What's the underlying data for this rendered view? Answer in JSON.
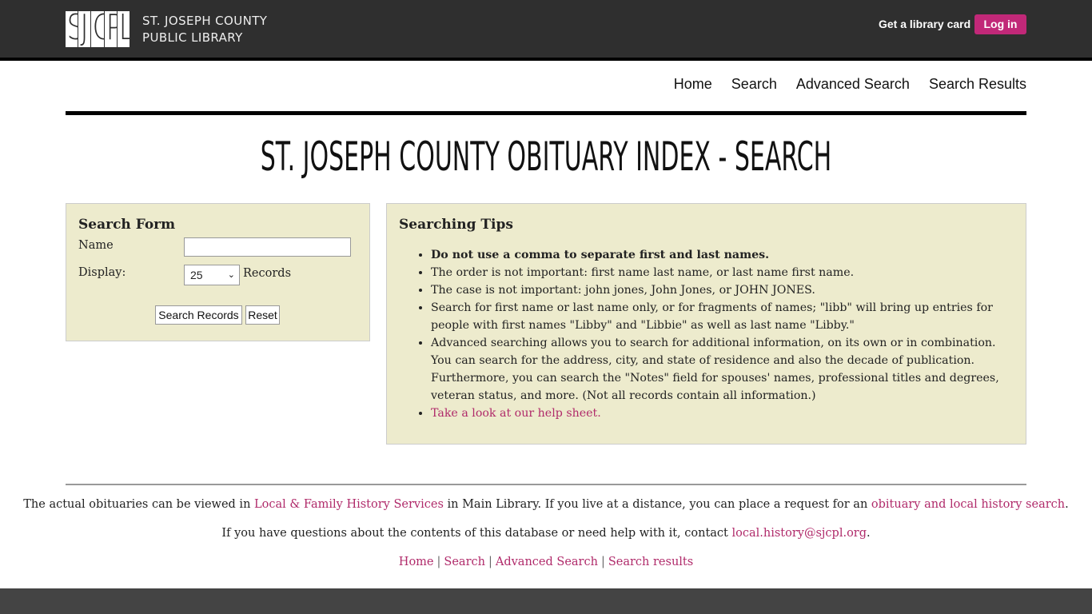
{
  "header": {
    "logo_letters": [
      "S",
      "J",
      "C",
      "P",
      "L"
    ],
    "org_line1": "ST. JOSEPH COUNTY",
    "org_line2": "PUBLIC LIBRARY",
    "get_card": "Get a library card",
    "login": "Log in",
    "accent_color": "#c12878"
  },
  "nav": {
    "items": [
      "Home",
      "Search",
      "Advanced Search",
      "Search Results"
    ]
  },
  "page_title": "ST. JOSEPH COUNTY OBITUARY INDEX - SEARCH",
  "search_form": {
    "heading": "Search Form",
    "name_label": "Name",
    "name_value": "",
    "display_label": "Display:",
    "display_value": "25",
    "records_label": "Records",
    "search_button": "Search Records",
    "reset_button": "Reset"
  },
  "tips": {
    "heading": "Searching Tips",
    "items": [
      "Do not use a comma to separate first and last names.",
      "The order is not important: first name last name, or last name first name.",
      "The case is not important: john jones, John Jones, or JOHN JONES.",
      "Search for first name or last name only, or for fragments of names; \"libb\" will bring up entries for people with first names \"Libby\" and \"Libbie\" as well as last name \"Libby.\"",
      "Advanced searching allows you to search for additional information, on its own or in combination. You can search for the address, city, and state of residence and also the decade of publication. Furthermore, you can search the \"Notes\" field for spouses' names, professional titles and degrees, veteran status, and more. (Not all records contain all information.)",
      "Take a look at our help sheet."
    ]
  },
  "footer": {
    "line1_pre": "The actual obituaries can be viewed in ",
    "line1_link1": "Local & Family History Services",
    "line1_mid": " in Main Library. If you live at a distance, you can place a request for an ",
    "line1_link2": "obituary and local history search",
    "line1_post": ".",
    "line2_pre": "If you have questions about the contents of this database or need help with it, contact ",
    "line2_link": "local.history@sjcpl.org",
    "line2_post": ".",
    "links": [
      "Home",
      "Search",
      "Advanced Search",
      "Search results"
    ],
    "separator": "|",
    "link_color": "#b02a6a"
  }
}
